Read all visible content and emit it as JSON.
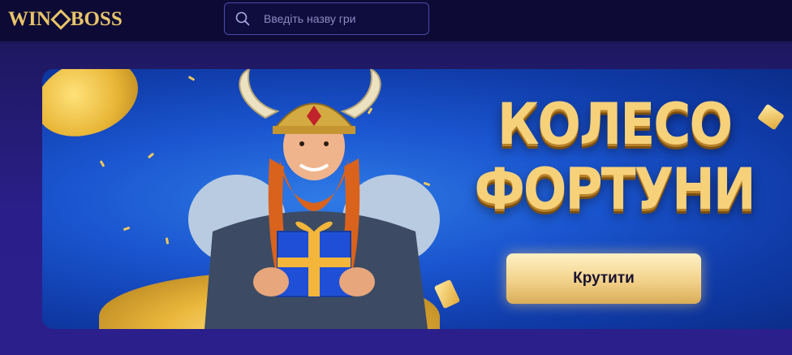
{
  "header": {
    "logo_text_left": "WIN",
    "logo_text_right": "BOSS",
    "search": {
      "placeholder": "Введіть назву гри",
      "value": ""
    }
  },
  "banner": {
    "title_line1": "КОЛЕСО",
    "title_line2": "ФОРТУНИ",
    "button_label": "Крутити"
  },
  "icons": {
    "search": "search-icon",
    "logo_diamond": "diamond-icon"
  },
  "colors": {
    "header_bg": "#0d0b35",
    "page_bg": "#2a1f8a",
    "banner_blue": "#1a55cf",
    "gold": "#f6d17a",
    "button_gold": "#f2d28a"
  }
}
